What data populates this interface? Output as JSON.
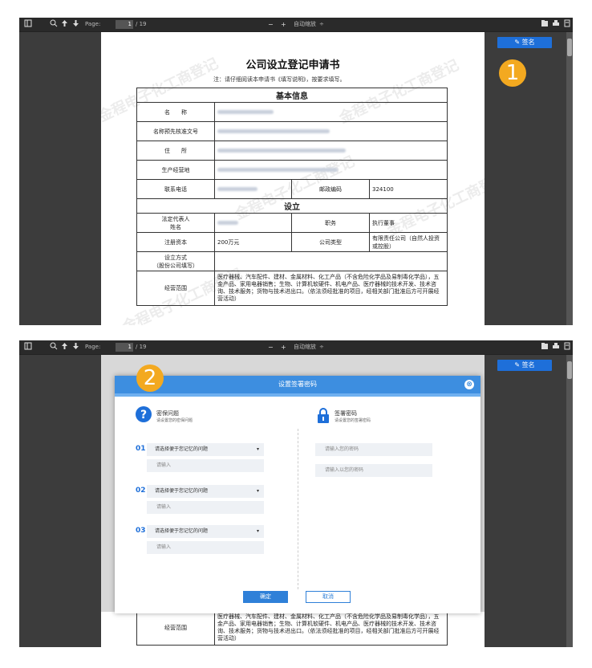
{
  "toolbar": {
    "page_label": "Page:",
    "page_current": "1",
    "page_total": "/ 19",
    "zoom_minus": "−",
    "zoom_plus": "+",
    "zoom_select": "自动缩放",
    "zoom_arrow": "÷"
  },
  "sign_button": "签名",
  "badges": [
    "1",
    "2"
  ],
  "document": {
    "title": "公司设立登记申请书",
    "note": "注：请仔细阅读本申请书《填写说明》，按要求填写。",
    "section_basic": "基本信息",
    "section_setup": "设立",
    "rows": {
      "name": "名　　称",
      "name_approval": "名称预先核准文号",
      "address": "住　　所",
      "production_address": "生产经营地",
      "phone": "联系电话",
      "postcode_label": "邮政编码",
      "postcode_value": "324100",
      "legal_rep": "法定代表人\n姓名",
      "position_label": "职务",
      "position_value": "执行董事",
      "capital_label": "注册资本",
      "capital_value": "200万元",
      "company_type_label": "公司类型",
      "company_type_value": "有限责任公司（自然人投资或控股）",
      "setup_method": "设立方式\n（股份公司填写）",
      "scope_label": "经营范围",
      "scope_value": "医疗器械、汽车配件、建材、金属材料、化工产品（不含危险化学品及易制毒化学品），五金产品、家用电器销售；生物、计算机软硬件、机电产品、医疗器械的技术开发、技术咨询、技术服务；货物与技术进出口。（依法须经批准的项目，经相关部门批准后方可开展经营活动）"
    },
    "watermark": "金程电子化工商登记"
  },
  "modal": {
    "title": "设置签署密码",
    "close": "⊗",
    "left_title": "密保问题",
    "left_sub": "请设置您的密保问题",
    "right_title": "签署密码",
    "right_sub": "请设置您的签署密码",
    "questions": [
      {
        "num": "01",
        "select": "请选择便于您记忆的问题",
        "input": "请输入"
      },
      {
        "num": "02",
        "select": "请选择便于您记忆的问题",
        "input": "请输入"
      },
      {
        "num": "03",
        "select": "请选择便于您记忆的问题",
        "input": "请输入"
      }
    ],
    "pwd_placeholder": "请输入您的密码",
    "pwd_confirm_placeholder": "请输入以您的密码",
    "ok": "确定",
    "cancel": "取消"
  },
  "colors": {
    "accent": "#1e6fd9",
    "badge": "#f3a920",
    "modal_header": "#3d8ee0"
  }
}
